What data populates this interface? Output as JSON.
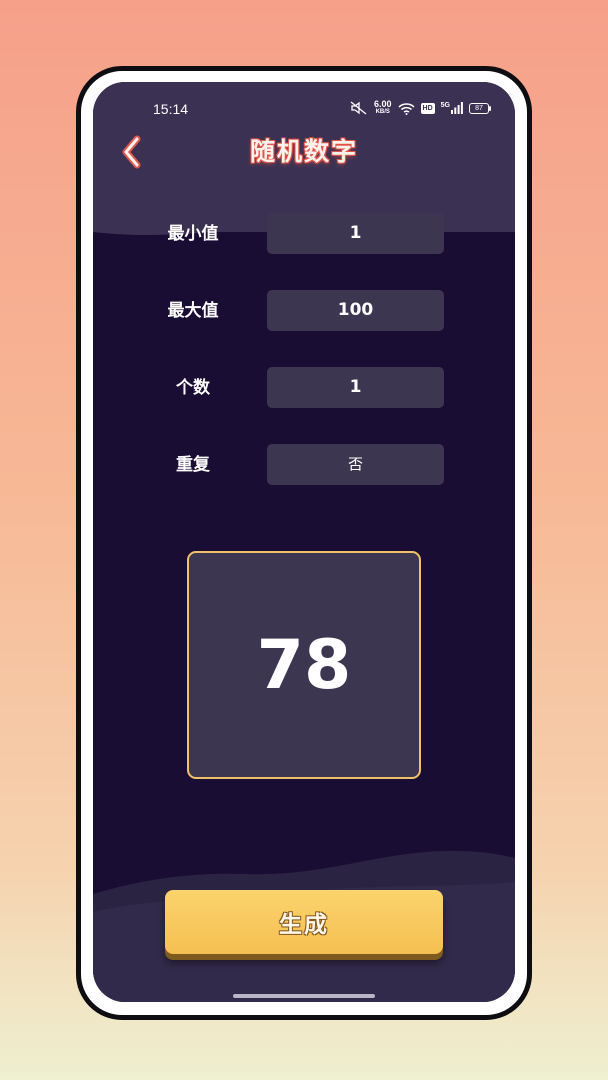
{
  "status_bar": {
    "time": "15:14",
    "net_speed_value": "6.00",
    "net_speed_unit": "KB/S",
    "hd_label": "HD",
    "signal_label": "5G",
    "battery": "87"
  },
  "header": {
    "title": "随机数字",
    "back_icon": "chevron-left-icon"
  },
  "fields": {
    "min": {
      "label": "最小值",
      "value": "1"
    },
    "max": {
      "label": "最大值",
      "value": "100"
    },
    "count": {
      "label": "个数",
      "value": "1"
    },
    "repeat": {
      "label": "重复",
      "value": "否"
    }
  },
  "result": {
    "value": "78"
  },
  "actions": {
    "generate_label": "生成"
  },
  "colors": {
    "background": "#1a0d33",
    "panel": "#3d3651",
    "accent": "#f6bf52",
    "title_glow": "#e2554a",
    "result_border": "#f1c068"
  }
}
